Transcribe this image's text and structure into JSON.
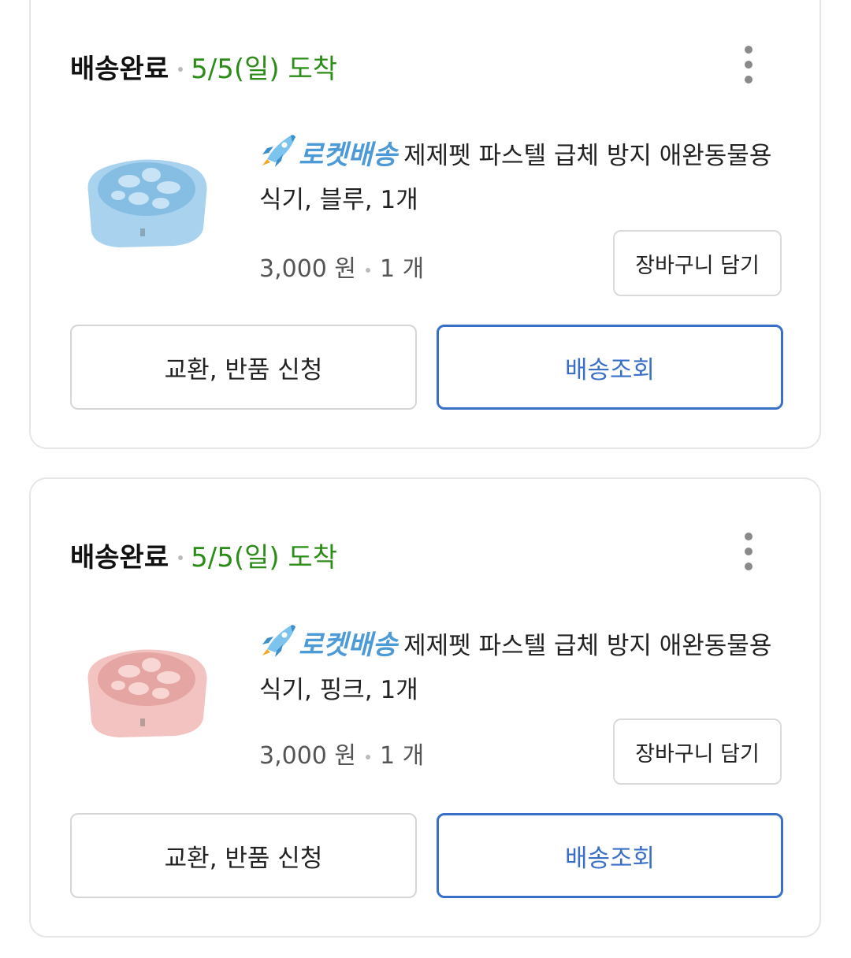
{
  "orders": [
    {
      "status": "배송완료",
      "arrival": "5/5(일) 도착",
      "badge": "로켓배송",
      "product_name": "제제펫 파스텔 급체 방지 애완동물용 식기, 블루, 1개",
      "price": "3,000 원",
      "quantity": "1 개",
      "cart_button": "장바구니 담기",
      "return_button": "교환, 반품 신청",
      "track_button": "배송조회",
      "bowl_color": "#a9d2ee",
      "bowl_shade": "#86bde3"
    },
    {
      "status": "배송완료",
      "arrival": "5/5(일) 도착",
      "badge": "로켓배송",
      "product_name": "제제펫 파스텔 급체 방지 애완동물용 식기, 핑크, 1개",
      "price": "3,000 원",
      "quantity": "1 개",
      "cart_button": "장바구니 담기",
      "return_button": "교환, 반품 신청",
      "track_button": "배송조회",
      "bowl_color": "#f2c3c0",
      "bowl_shade": "#e5a5a2"
    }
  ],
  "colors": {
    "arrival_green": "#2c8c18",
    "rocket_blue": "#4d9bd6",
    "track_blue": "#3a6fc7"
  },
  "icons": [
    "kebab-menu-icon",
    "rocket-icon"
  ]
}
